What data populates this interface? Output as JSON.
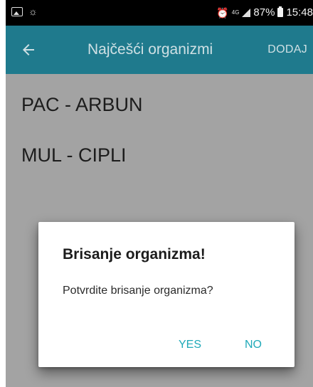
{
  "status_bar": {
    "network": "4G",
    "battery": "87%",
    "time": "15:48",
    "left_icons": [
      "gallery-icon",
      "weather-icon"
    ],
    "right_icons": [
      "alarm-icon",
      "signal-icon",
      "battery-icon"
    ]
  },
  "app_bar": {
    "title": "Najčešći organizmi",
    "action_label": "DODAJ",
    "back_icon": "arrow-left-icon",
    "color": "#1f7a8d"
  },
  "list": {
    "items": [
      {
        "label": "PAC - ARBUN"
      },
      {
        "label": "MUL - CIPLI"
      }
    ]
  },
  "dialog": {
    "title": "Brisanje organizma!",
    "message": "Potvrdite brisanje organizma?",
    "buttons": {
      "yes": "YES",
      "no": "NO"
    },
    "accent_color": "#1fa9b8"
  }
}
